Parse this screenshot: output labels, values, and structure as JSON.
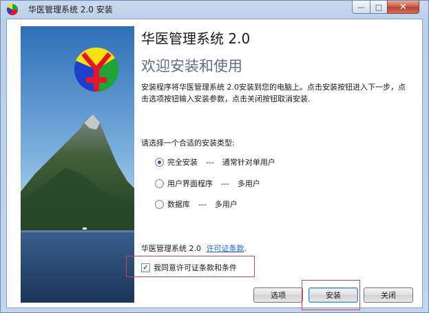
{
  "window": {
    "title": "华医管理系统 2.0 安装",
    "controls": {
      "minimize": "—",
      "maximize": "□",
      "close": "✕"
    }
  },
  "header": {
    "title": "华医管理系统 2.0",
    "subtitle": "欢迎安装和使用"
  },
  "description": "安装程序将华医管理系统 2.0安装到您的电脑上。点击安装按钮进入下一步，点击选项按钮输入安装参数，点击关闭按钮取消安装.",
  "install_type": {
    "prompt": "请选择一个合适的安装类型:",
    "separator": "---",
    "selected": "完全安装",
    "options": [
      {
        "label": "完全安装",
        "note": "通常针对单用户",
        "checked": true
      },
      {
        "label": "用户界面程序",
        "note": "多用户",
        "checked": false
      },
      {
        "label": "数据库",
        "note": "多用户",
        "checked": false
      }
    ]
  },
  "license": {
    "product": "华医管理系统 2.0",
    "link_text": "许可证条款",
    "suffix": ".",
    "agree_label": "我同意许可证条款和条件",
    "agree_checked": true
  },
  "buttons": {
    "options": "选项",
    "install": "安装",
    "close": "关闭"
  },
  "colors": {
    "highlight": "#d0454d",
    "link": "#1b66c9",
    "logo_yellow": "#f5e210",
    "logo_red": "#e5142b",
    "logo_green": "#22a336",
    "logo_blue": "#1f3ec9"
  }
}
